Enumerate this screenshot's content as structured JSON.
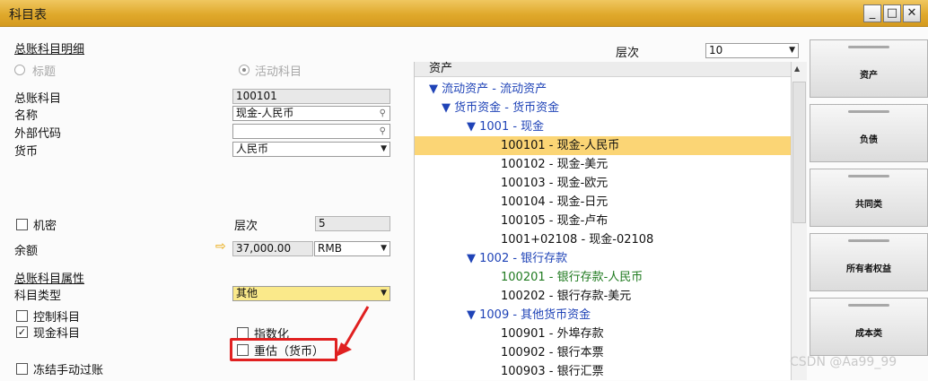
{
  "window": {
    "title": "科目表",
    "minimize": "_",
    "maximize": "□",
    "close": "✕"
  },
  "details": {
    "section_title": "总账科目明细",
    "radio_title": "标题",
    "radio_active": "活动科目",
    "gl_account_label": "总账科目",
    "gl_account_value": "100101",
    "name_label": "名称",
    "name_value": "现金-人民币",
    "external_code_label": "外部代码",
    "external_code_value": "",
    "currency_label": "货币",
    "currency_value": "人民币",
    "confidential_label": "机密",
    "level_label": "层次",
    "level_value": "5",
    "balance_label": "余额",
    "balance_arrow": "⇨",
    "balance_value": "37,000.00",
    "balance_currency": "RMB"
  },
  "properties": {
    "section_title": "总账科目属性",
    "account_type_label": "科目类型",
    "account_type_value": "其他",
    "control_account": "控制科目",
    "cash_account": "现金科目",
    "indexed": "指数化",
    "revaluation": "重估（货币）",
    "freeze_manual": "冻结手动过账"
  },
  "tree": {
    "level_label": "层次",
    "level_value": "10",
    "header": "资产",
    "rows": [
      {
        "text": "▼ 流动资产 - 流动资产",
        "color": "blue"
      },
      {
        "text": "▼ 货币资金 - 货币资金",
        "color": "blue"
      },
      {
        "text": "▼ 1001 - 现金",
        "color": "blue"
      },
      {
        "text": "100101 - 现金-人民币",
        "color": "black",
        "selected": true
      },
      {
        "text": "100102 - 现金-美元",
        "color": "black"
      },
      {
        "text": "100103 - 现金-欧元",
        "color": "black"
      },
      {
        "text": "100104 - 现金-日元",
        "color": "black"
      },
      {
        "text": "100105 - 现金-卢布",
        "color": "black"
      },
      {
        "text": "1001+02108 - 现金-02108",
        "color": "black"
      },
      {
        "text": "▼ 1002 - 银行存款",
        "color": "blue"
      },
      {
        "text": "100201 - 银行存款-人民币",
        "color": "green"
      },
      {
        "text": "100202 - 银行存款-美元",
        "color": "black"
      },
      {
        "text": "▼ 1009 - 其他货币资金",
        "color": "blue"
      },
      {
        "text": "100901 - 外埠存款",
        "color": "black"
      },
      {
        "text": "100902 - 银行本票",
        "color": "black"
      },
      {
        "text": "100903 - 银行汇票",
        "color": "black"
      }
    ]
  },
  "tabs": [
    "资产",
    "负债",
    "共同类",
    "所有者权益",
    "成本类"
  ],
  "watermark": "CSDN @Aa99_99",
  "colors": {
    "title_bar": "#e0a92c",
    "selected_row": "#fbd575",
    "highlight_box": "#e02020"
  }
}
